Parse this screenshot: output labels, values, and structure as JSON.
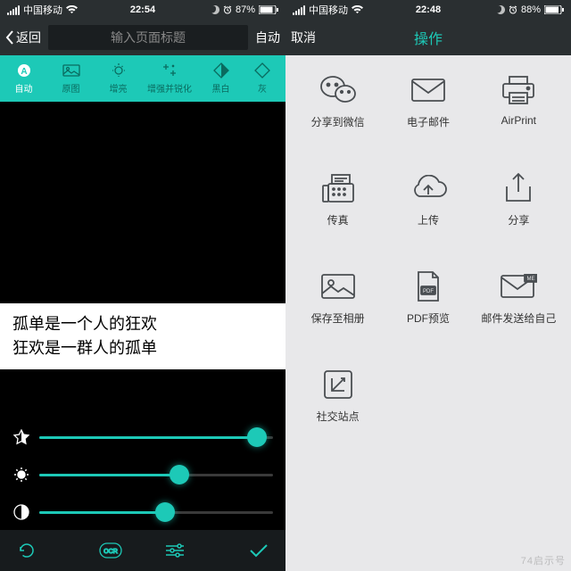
{
  "left": {
    "status": {
      "carrier": "中国移动",
      "time": "22:54",
      "battery": "87%"
    },
    "nav": {
      "back": "返回",
      "title_placeholder": "输入页面标题",
      "auto": "自动"
    },
    "tabs": [
      {
        "label": "自动"
      },
      {
        "label": "原图"
      },
      {
        "label": "增亮"
      },
      {
        "label": "增强并锐化"
      },
      {
        "label": "黑白"
      },
      {
        "label": "灰"
      }
    ],
    "handwriting": {
      "line1": "孤单是一个人的狂欢",
      "line2": "狂欢是一群人的孤单"
    },
    "sliders": {
      "star": 93,
      "sun": 60,
      "contrast": 54
    }
  },
  "right": {
    "status": {
      "carrier": "中国移动",
      "time": "22:48",
      "battery": "88%"
    },
    "nav": {
      "cancel": "取消",
      "title": "操作"
    },
    "actions": [
      {
        "label": "分享到微信",
        "icon": "wechat"
      },
      {
        "label": "电子邮件",
        "icon": "mail"
      },
      {
        "label": "AirPrint",
        "icon": "printer"
      },
      {
        "label": "传真",
        "icon": "fax"
      },
      {
        "label": "上传",
        "icon": "upload-cloud"
      },
      {
        "label": "分享",
        "icon": "share"
      },
      {
        "label": "保存至相册",
        "icon": "album"
      },
      {
        "label": "PDF预览",
        "icon": "pdf"
      },
      {
        "label": "邮件发送给自己",
        "icon": "mail-me"
      },
      {
        "label": "社交站点",
        "icon": "social"
      }
    ]
  },
  "watermark": "74启示号"
}
